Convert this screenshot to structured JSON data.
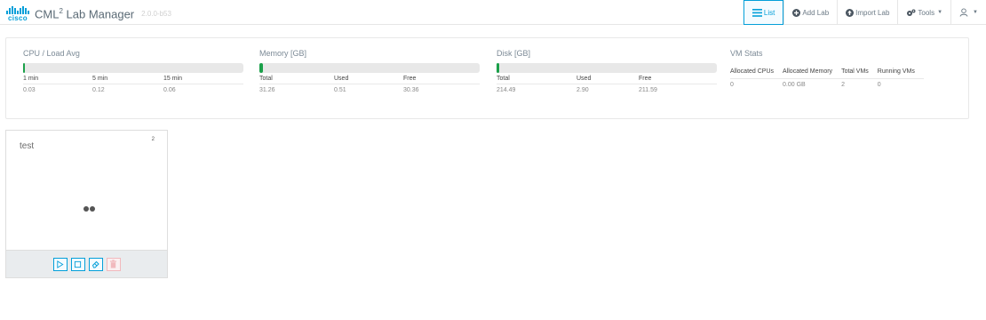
{
  "header": {
    "logo_text": "cisco",
    "app_name": "CML",
    "app_name_sup": "2",
    "app_name_suffix": " Lab Manager",
    "version": "2.0.0-b53",
    "nav": {
      "list": "List",
      "add_lab": "Add Lab",
      "import_lab": "Import Lab",
      "tools": "Tools"
    }
  },
  "stats": {
    "cpu": {
      "title": "CPU / Load Avg",
      "usage_percent": 0.5,
      "headers": [
        "1 min",
        "5 min",
        "15 min"
      ],
      "values": [
        "0.03",
        "0.12",
        "0.06"
      ]
    },
    "memory": {
      "title": "Memory [GB]",
      "usage_percent": 1.6,
      "headers": [
        "Total",
        "Used",
        "Free"
      ],
      "values": [
        "31.26",
        "0.51",
        "30.36"
      ]
    },
    "disk": {
      "title": "Disk [GB]",
      "usage_percent": 1.4,
      "headers": [
        "Total",
        "Used",
        "Free"
      ],
      "values": [
        "214.49",
        "2.90",
        "211.59"
      ]
    },
    "vm": {
      "title": "VM Stats",
      "headers": [
        "Allocated CPUs",
        "Allocated Memory",
        "Total VMs",
        "Running VMs"
      ],
      "values": [
        "0",
        "0.00 GB",
        "2",
        "0"
      ]
    }
  },
  "labs": [
    {
      "title": "test",
      "node_count": "2"
    }
  ],
  "colors": {
    "accent": "#049fd9",
    "usage_bar": "#1ba04a",
    "danger_light": "#f1b9bd"
  }
}
